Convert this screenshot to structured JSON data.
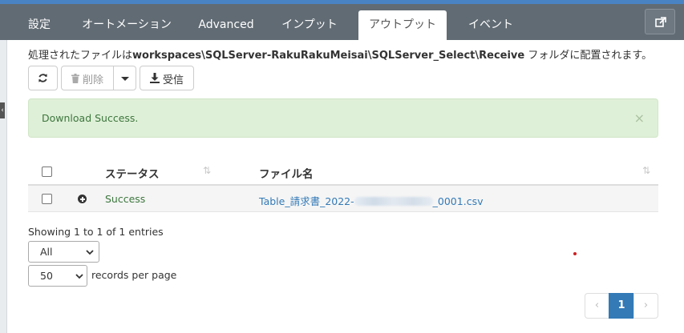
{
  "tabs": [
    {
      "label": "設定",
      "active": false
    },
    {
      "label": "オートメーション",
      "active": false
    },
    {
      "label": "Advanced",
      "active": false
    },
    {
      "label": "インプット",
      "active": false
    },
    {
      "label": "アウトプット",
      "active": true
    },
    {
      "label": "イベント",
      "active": false
    }
  ],
  "info": {
    "prefix": "処理されたファイルは",
    "path": "workspaces\\SQLServer-RakuRakuMeisai\\SQLServer_Select\\Receive",
    "suffix": " フォルダに配置されます。"
  },
  "toolbar": {
    "delete_label": "削除",
    "receive_label": "受信"
  },
  "alert": {
    "message": "Download Success.",
    "close": "×"
  },
  "table": {
    "headers": {
      "status": "ステータス",
      "filename": "ファイル名"
    },
    "rows": [
      {
        "status": "Success",
        "filename_prefix": "Table_請求書_2022-",
        "filename_suffix": "_0001.csv"
      }
    ]
  },
  "footer": {
    "entries_text": "Showing 1 to 1 of 1 entries",
    "filter_select": "All",
    "page_size": "50",
    "records_per_page": "records per page"
  },
  "pagination": {
    "prev": "‹",
    "current": "1",
    "next": "›"
  },
  "colors": {
    "tabbar": "#616b74",
    "success_bg": "#dff0d8",
    "success_text": "#3c763d",
    "link": "#337ab7"
  }
}
